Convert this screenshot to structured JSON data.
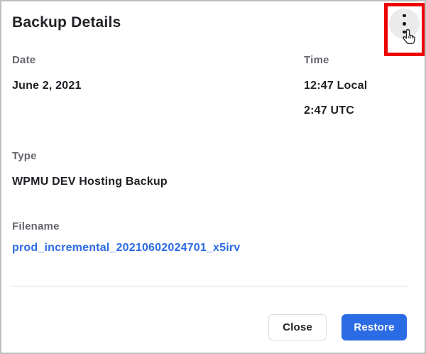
{
  "dialog": {
    "title": "Backup Details",
    "fields": {
      "date": {
        "label": "Date",
        "value": "June 2, 2021"
      },
      "time": {
        "label": "Time",
        "local": "12:47 Local",
        "utc": "2:47 UTC"
      },
      "type": {
        "label": "Type",
        "value": "WPMU DEV Hosting Backup"
      },
      "filename": {
        "label": "Filename",
        "value": "prod_incremental_20210602024701_x5irv"
      }
    },
    "menu": {
      "icon": "kebab-menu-icon",
      "annotation": "red-highlight-box-with-hand-cursor"
    },
    "footer": {
      "close_label": "Close",
      "restore_label": "Restore"
    },
    "colors": {
      "accent_blue": "#2b6be4",
      "link_blue": "#2b6be4",
      "highlight_red": "#ee0000",
      "label_gray": "#64666c",
      "text_dark": "#1d1f23",
      "circle_gray": "#ebebeb",
      "border_gray": "#bdbdbd"
    }
  }
}
